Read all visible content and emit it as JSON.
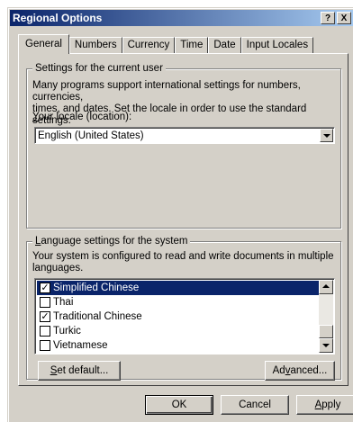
{
  "window": {
    "title": "Regional Options",
    "help_label": "?",
    "close_label": "X"
  },
  "tabs": [
    {
      "label": "General",
      "active": true
    },
    {
      "label": "Numbers",
      "active": false
    },
    {
      "label": "Currency",
      "active": false
    },
    {
      "label": "Time",
      "active": false
    },
    {
      "label": "Date",
      "active": false
    },
    {
      "label": "Input Locales",
      "active": false
    }
  ],
  "current_user": {
    "group_label": "Settings for the current user",
    "description_line1": "Many programs support international settings for numbers, currencies,",
    "description_line2": "times, and dates. Set the locale in order to use the standard settings.",
    "locale_label_accel": "Y",
    "locale_label_rest": "our locale (location):",
    "locale_value": "English (United States)"
  },
  "language_settings": {
    "group_label_accel": "L",
    "group_label_rest": "anguage settings for the system",
    "description_line1": "Your system is configured to read and write documents in multiple",
    "description_line2": "languages.",
    "items": [
      {
        "label": "Simplified Chinese",
        "checked": true,
        "selected": true
      },
      {
        "label": "Thai",
        "checked": false,
        "selected": false
      },
      {
        "label": "Traditional Chinese",
        "checked": true,
        "selected": false
      },
      {
        "label": "Turkic",
        "checked": false,
        "selected": false
      },
      {
        "label": "Vietnamese",
        "checked": false,
        "selected": false
      }
    ],
    "set_default_accel": "S",
    "set_default_rest": "et default...",
    "advanced_pre": "Ad",
    "advanced_accel": "v",
    "advanced_post": "anced..."
  },
  "footer": {
    "ok_label": "OK",
    "cancel_label": "Cancel",
    "apply_accel": "A",
    "apply_rest": "pply"
  },
  "check_mark": "✓"
}
